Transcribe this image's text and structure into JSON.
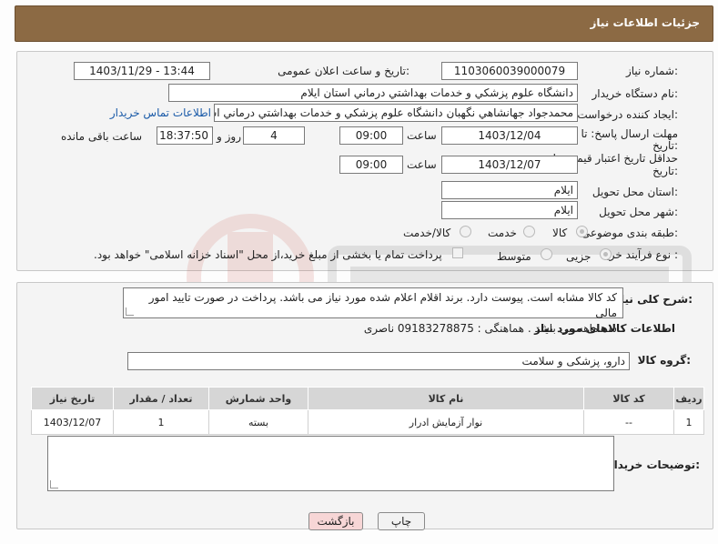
{
  "header": {
    "title": "جزئیات اطلاعات نیاز"
  },
  "form": {
    "need_number_label": "شماره نیاز:",
    "need_number": "1103060039000079",
    "announce_label": "تاریخ و ساعت اعلان عمومی:",
    "announce_value": "1403/11/29 - 13:44",
    "buyer_org_label": "نام دستگاه خریدار:",
    "buyer_org": "دانشگاه علوم پزشکي و خدمات بهداشتي درماني استان ايلام",
    "creator_label": "ایجاد کننده درخواست:",
    "creator": "محمدجواد جهانشاهي نگهبان دانشگاه علوم پزشکي و خدمات بهداشتي درماني استان ايلام",
    "contact_link": "اطلاعات تماس خریدار",
    "deadline_label_1": "مهلت ارسال پاسخ: تا",
    "deadline_label_2": "تاریخ:",
    "deadline_date": "1403/12/04",
    "time_label": "ساعت",
    "deadline_time": "09:00",
    "days_value": "4",
    "days_label": "روز و",
    "remaining_time": "18:37:50",
    "remaining_label": "ساعت باقی مانده",
    "validity_label_1": "حداقل تاریخ اعتبار قیمت: تا",
    "validity_label_2": "تاریخ:",
    "validity_date": "1403/12/07",
    "validity_time": "09:00",
    "province_label": "استان محل تحویل:",
    "province": "ايلام",
    "city_label": "شهر محل تحویل:",
    "city": "ايلام",
    "category_label": "طبقه بندی موضوعی:",
    "category_options": [
      "کالا",
      "خدمت",
      "کالا/خدمت"
    ],
    "process_label": "نوع فرآیند خرید :",
    "process_options": [
      "جزیی",
      "متوسط"
    ],
    "payment_note": "پرداخت تمام یا بخشی از مبلغ خرید،از محل \"اسناد خزانه اسلامی\" خواهد بود."
  },
  "description": {
    "label": "شرح کلی نیاز:",
    "line1": "کد کالا مشابه است. پیوست دارد. برند اقلام اعلام شده مورد نیاز می باشد. پرداخت در صورت تایید امور مالی",
    "line2": "سه ماهه می باشد . هماهنگی : 09183278875 ناصری"
  },
  "goods": {
    "section_title": "اطلاعات کالاهای مورد نیاز",
    "group_label": "گروه کالا:",
    "group_value": "دارو، پزشکی و سلامت",
    "columns": [
      "ردیف",
      "کد کالا",
      "نام کالا",
      "واحد شمارش",
      "تعداد / مقدار",
      "تاریخ نیاز"
    ],
    "rows": [
      [
        "1",
        "--",
        "نوار آزمایش ادرار",
        "بسته",
        "1",
        "1403/12/07"
      ]
    ]
  },
  "buyer_notes": {
    "label": "توضیحات خریدار:",
    "value": ""
  },
  "buttons": {
    "print": "چاپ",
    "back": "بازگشت"
  },
  "colors": {
    "header_bg": "#8c6a44",
    "back_button_bg": "#f7d6d6",
    "link": "#1a5aa8"
  }
}
